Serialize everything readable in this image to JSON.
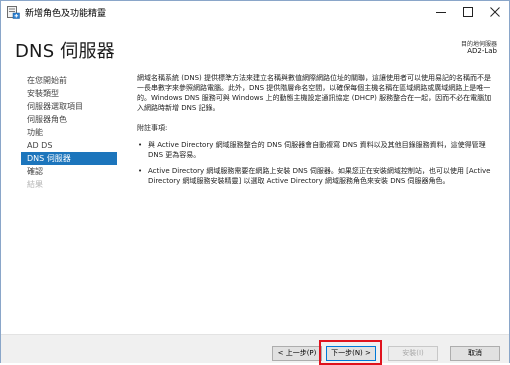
{
  "window": {
    "title": "新增角色及功能精靈",
    "min_glyph": "—",
    "max_glyph": "☐",
    "close_glyph": "✕"
  },
  "header": {
    "title": "DNS 伺服器",
    "target_label": "目的地伺服器",
    "target_value": "AD2-Lab"
  },
  "nav": {
    "items": [
      {
        "label": "在您開始前",
        "state": "normal"
      },
      {
        "label": "安裝類型",
        "state": "normal"
      },
      {
        "label": "伺服器選取項目",
        "state": "normal"
      },
      {
        "label": "伺服器角色",
        "state": "normal"
      },
      {
        "label": "功能",
        "state": "normal"
      },
      {
        "label": "AD DS",
        "state": "normal"
      },
      {
        "label": "DNS 伺服器",
        "state": "active"
      },
      {
        "label": "確認",
        "state": "normal"
      },
      {
        "label": "結果",
        "state": "disabled"
      }
    ]
  },
  "content": {
    "intro": "網域名稱系統 (DNS) 提供標準方法來建立名稱與數值網際網路位址的關聯，這讓使用者可以使用易記的名稱而不是一長串數字來參照網路電腦。此外，DNS 提供階層命名空間，以確保每個主機名稱在區域網路或廣域網路上是唯一的。Windows DNS 服務可與 Windows 上的動態主機設定通訊協定 (DHCP) 服務整合在一起，因而不必在電腦加入網路時新增 DNS 記錄。",
    "notes_title": "附註事項:",
    "bullets": [
      "與 Active Directory 網域服務整合的 DNS 伺服器會自動複寫 DNS 資料以及其他目錄服務資料，這使得管理 DNS 更為容易。",
      "Active Directory 網域服務需要在網路上安裝 DNS 伺服器。如果您正在安裝網域控制站，也可以使用 [Active Directory 網域服務安裝精靈] 以選取 Active Directory 網域服務角色來安裝 DNS 伺服器角色。"
    ],
    "bullet_glyph": "•"
  },
  "footer": {
    "prev_label": "< 上一步(P)",
    "next_label": "下一步(N) >",
    "install_label": "安裝(I)",
    "cancel_label": "取消"
  },
  "colors": {
    "active_nav": "#1c75bc",
    "highlight": "#e0121d",
    "focus_border": "#0078d7"
  }
}
